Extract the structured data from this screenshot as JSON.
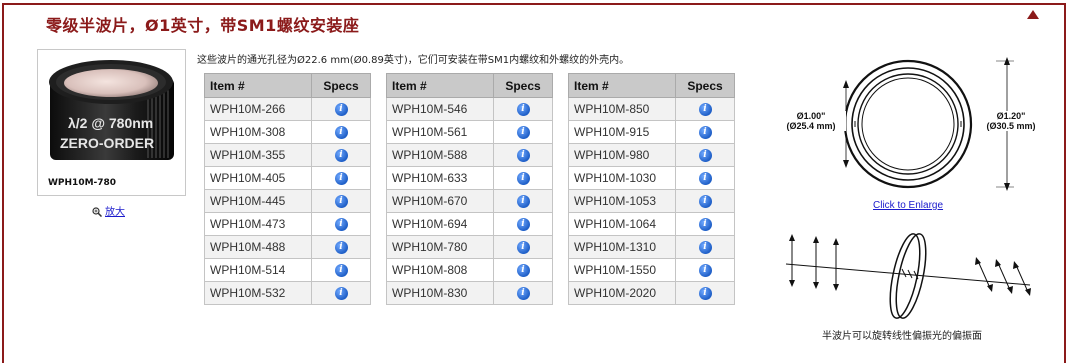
{
  "title": "零级半波片，Ø1英寸，带SM1螺纹安装座",
  "product": {
    "caption": "WPH10M-780",
    "lens_text_line1": "λ/2 @ 780nm",
    "lens_text_line2": "ZERO-ORDER",
    "zoom_label": "放大"
  },
  "description": "这些波片的通光孔径为Ø22.6 mm(Ø0.89英寸)，它们可安装在带SM1内螺纹和外螺纹的外壳内。",
  "table_headers": {
    "item": "Item #",
    "specs": "Specs"
  },
  "table1": [
    "WPH10M-266",
    "WPH10M-308",
    "WPH10M-355",
    "WPH10M-405",
    "WPH10M-445",
    "WPH10M-473",
    "WPH10M-488",
    "WPH10M-514",
    "WPH10M-532"
  ],
  "table2": [
    "WPH10M-546",
    "WPH10M-561",
    "WPH10M-588",
    "WPH10M-633",
    "WPH10M-670",
    "WPH10M-694",
    "WPH10M-780",
    "WPH10M-808",
    "WPH10M-830"
  ],
  "table3": [
    "WPH10M-850",
    "WPH10M-915",
    "WPH10M-980",
    "WPH10M-1030",
    "WPH10M-1053",
    "WPH10M-1064",
    "WPH10M-1310",
    "WPH10M-1550",
    "WPH10M-2020"
  ],
  "specs_icon": "info-icon",
  "diagram": {
    "inner_dim_line1": "Ø1.00\"",
    "inner_dim_line2": "(Ø25.4 mm)",
    "outer_dim_line1": "Ø1.20\"",
    "outer_dim_line2": "(Ø30.5 mm)",
    "enlarge_link": "Click to Enlarge"
  },
  "wave_caption": "半波片可以旋转线性偏振光的偏振面",
  "colors": {
    "title": "#8b1a1a",
    "frame": "#8b1a1a",
    "link": "#1a1acc",
    "header_bg": "#c9c9c9",
    "info": "#1f5fc7"
  }
}
